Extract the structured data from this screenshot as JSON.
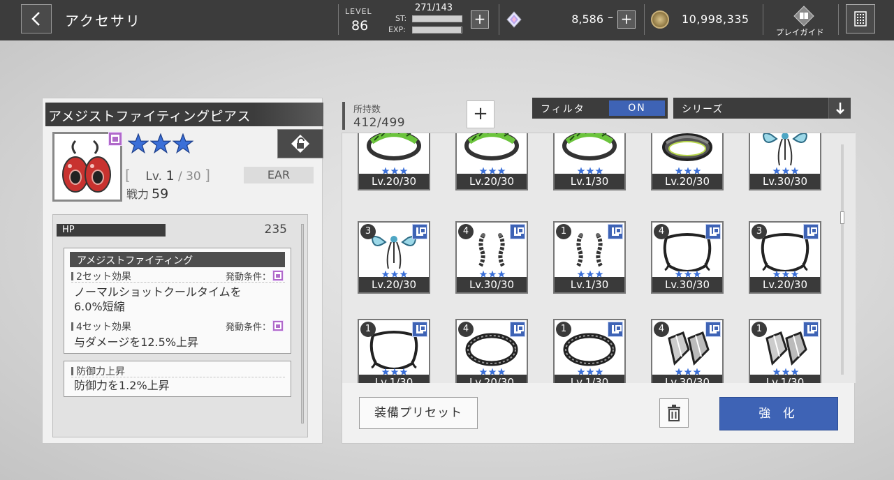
{
  "header": {
    "title": "アクセサリ",
    "level_label": "LEVEL",
    "level_value": "86",
    "st_label": "ST:",
    "st_value": "271/143",
    "st_fill": 1.0,
    "exp_label": "EXP:",
    "exp_fill": 0.98,
    "gem_value": "8,586",
    "gem_dash": "–",
    "coin_value": "10,998,335",
    "guide_label": "プレイガイド"
  },
  "detail": {
    "name": "アメジストファイティングピアス",
    "stars": 3,
    "lv_prefix": "Lv.",
    "lv_current": "1",
    "lv_max": "30",
    "slot": "EAR",
    "power_label": "戦力",
    "power_value": "59",
    "hp_label": "HP",
    "hp_value": "235",
    "set_title": "アメジストファイティング",
    "set2_label": "2セット効果",
    "set2_cond": "発動条件：",
    "set2_desc_1": "ノーマルショットクールタイムを",
    "set2_desc_2": "6.0%短縮",
    "set4_label": "4セット効果",
    "set4_cond": "発動条件：",
    "set4_desc": "与ダメージを12.5%上昇",
    "def_title": "防御力上昇",
    "def_desc": "防御力を1.2%上昇"
  },
  "inventory": {
    "own_label": "所持数",
    "own_value": "412/499",
    "filter_label": "フィルタ",
    "filter_state": "ON",
    "series_label": "シリーズ",
    "items": [
      {
        "level": "Lv.20/30",
        "count": "",
        "art": "ring-green",
        "badge": false
      },
      {
        "level": "Lv.20/30",
        "count": "",
        "art": "ring-green",
        "badge": false
      },
      {
        "level": "Lv.1/30",
        "count": "",
        "art": "ring-green",
        "badge": false
      },
      {
        "level": "Lv.20/30",
        "count": "",
        "art": "ring-dark",
        "badge": false
      },
      {
        "level": "Lv.30/30",
        "count": "",
        "art": "ribbon",
        "badge": false
      },
      {
        "level": "Lv.20/30",
        "count": "3",
        "art": "ribbon",
        "badge": true
      },
      {
        "level": "Lv.30/30",
        "count": "4",
        "art": "chain-ear",
        "badge": true
      },
      {
        "level": "Lv.1/30",
        "count": "1",
        "art": "chain-ear",
        "badge": true
      },
      {
        "level": "Lv.30/30",
        "count": "4",
        "art": "necklace",
        "badge": true
      },
      {
        "level": "Lv.20/30",
        "count": "3",
        "art": "necklace",
        "badge": true
      },
      {
        "level": "Lv.1/30",
        "count": "1",
        "art": "necklace",
        "badge": true
      },
      {
        "level": "Lv.20/30",
        "count": "4",
        "art": "bracelet",
        "badge": true
      },
      {
        "level": "Lv.1/30",
        "count": "1",
        "art": "bracelet",
        "badge": true
      },
      {
        "level": "Lv.30/30",
        "count": "4",
        "art": "gem-ear",
        "badge": true
      },
      {
        "level": "Lv.1/30",
        "count": "1",
        "art": "gem-ear",
        "badge": true
      }
    ],
    "preset_label": "装備プリセット",
    "enhance_label": "強 化"
  },
  "colors": {
    "topbar": "#3c3c3c",
    "accent_blue": "#3e63b5",
    "rarity_purple": "#b069c9",
    "star_blue": "#3a6fd8"
  },
  "icons": [
    "back-arrow-icon",
    "plus-icon",
    "gem-icon",
    "coin-icon",
    "guide-book-icon",
    "grid-menu-icon",
    "unlock-icon",
    "star-icon",
    "trash-icon",
    "sort-down-icon"
  ]
}
